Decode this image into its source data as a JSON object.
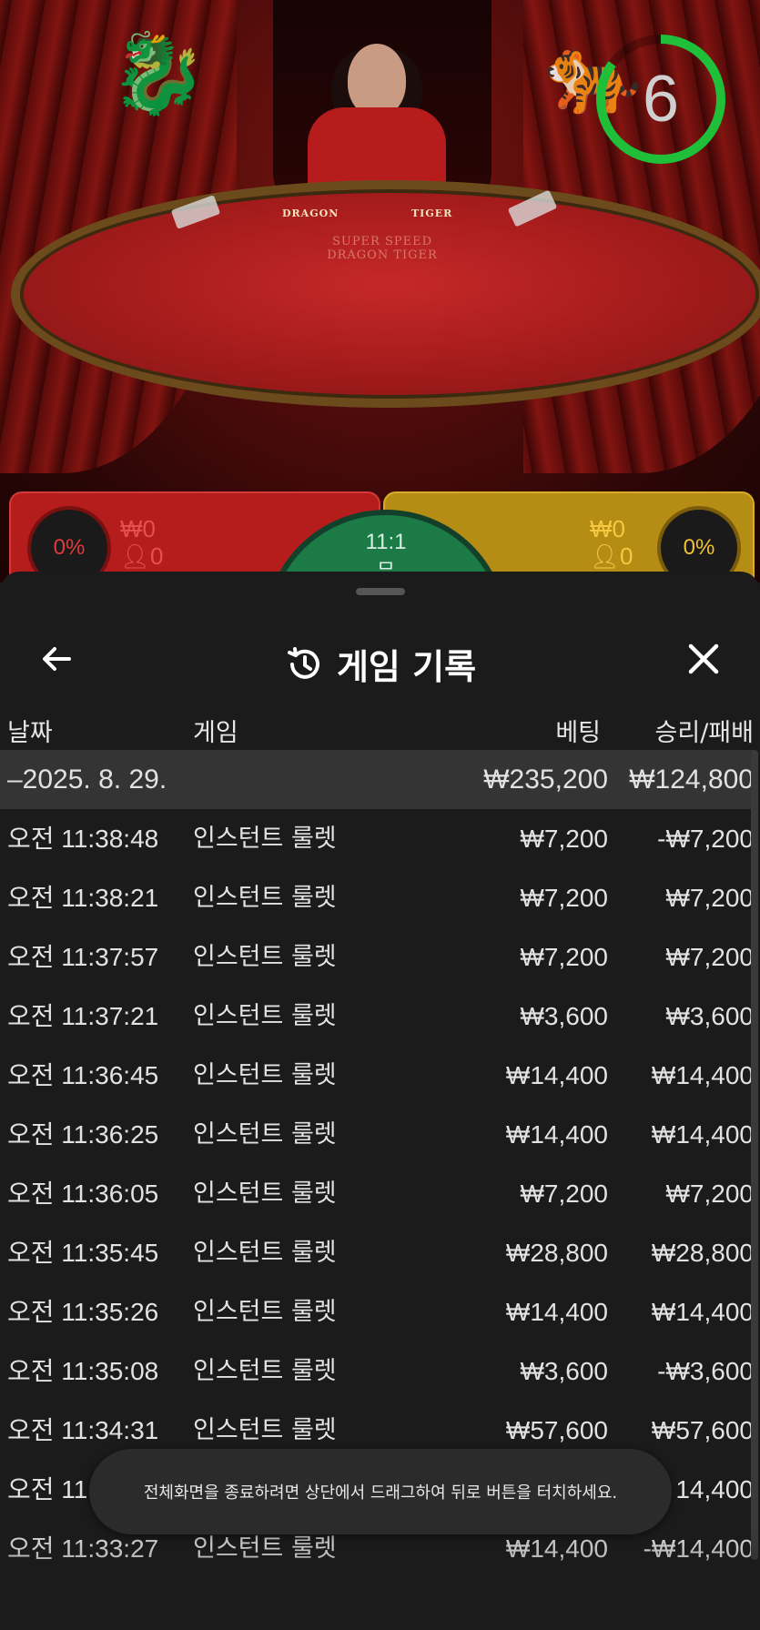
{
  "game_view": {
    "timer_value": "6",
    "timer_fraction": 0.85,
    "table_labels": {
      "dragon": "DRAGON",
      "tiger": "TIGER"
    },
    "table_logo": "SUPER SPEED DRAGON TIGER",
    "dragon_percent": "0%",
    "tiger_percent": "0%",
    "dragon_amount": "₩0",
    "dragon_players": "0",
    "tiger_amount": "₩0",
    "tiger_players": "0",
    "tie_payout": "11:1",
    "tie_glyph": "무",
    "colors": {
      "dragon": "#b51d1d",
      "tiger": "#b68d14",
      "tie": "#1c7a46",
      "timer": "#1fbf3a"
    }
  },
  "history_sheet": {
    "title": "게임 기록",
    "icons": {
      "back": "arrow-left-icon",
      "history": "history-icon",
      "close": "close-icon"
    },
    "columns": {
      "date": "날짜",
      "game": "게임",
      "bet": "베팅",
      "result": "승리/패배"
    },
    "date_group": {
      "date": "–2025. 8. 29.",
      "total_bet": "₩235,200",
      "total_result": "₩124,800"
    },
    "rows": [
      {
        "time": "오전 11:38:48",
        "game": "인스턴트 룰렛",
        "bet": "₩7,200",
        "result": "-₩7,200"
      },
      {
        "time": "오전 11:38:21",
        "game": "인스턴트 룰렛",
        "bet": "₩7,200",
        "result": "₩7,200"
      },
      {
        "time": "오전 11:37:57",
        "game": "인스턴트 룰렛",
        "bet": "₩7,200",
        "result": "₩7,200"
      },
      {
        "time": "오전 11:37:21",
        "game": "인스턴트 룰렛",
        "bet": "₩3,600",
        "result": "₩3,600"
      },
      {
        "time": "오전 11:36:45",
        "game": "인스턴트 룰렛",
        "bet": "₩14,400",
        "result": "₩14,400"
      },
      {
        "time": "오전 11:36:25",
        "game": "인스턴트 룰렛",
        "bet": "₩14,400",
        "result": "₩14,400"
      },
      {
        "time": "오전 11:36:05",
        "game": "인스턴트 룰렛",
        "bet": "₩7,200",
        "result": "₩7,200"
      },
      {
        "time": "오전 11:35:45",
        "game": "인스턴트 룰렛",
        "bet": "₩28,800",
        "result": "₩28,800"
      },
      {
        "time": "오전 11:35:26",
        "game": "인스턴트 룰렛",
        "bet": "₩14,400",
        "result": "₩14,400"
      },
      {
        "time": "오전 11:35:08",
        "game": "인스턴트 룰렛",
        "bet": "₩3,600",
        "result": "-₩3,600"
      },
      {
        "time": "오전 11:34:31",
        "game": "인스턴트 룰렛",
        "bet": "₩57,600",
        "result": "₩57,600"
      },
      {
        "time": "오전 11",
        "game": "",
        "bet": "",
        "result": "14,400"
      },
      {
        "time": "오전 11:33:27",
        "game": "인스턴트 룰렛",
        "bet": "₩14,400",
        "result": "-₩14,400"
      }
    ]
  },
  "toast": {
    "text": "전체화면을 종료하려면 상단에서 드래그하여 뒤로 버튼을 터치하세요."
  }
}
